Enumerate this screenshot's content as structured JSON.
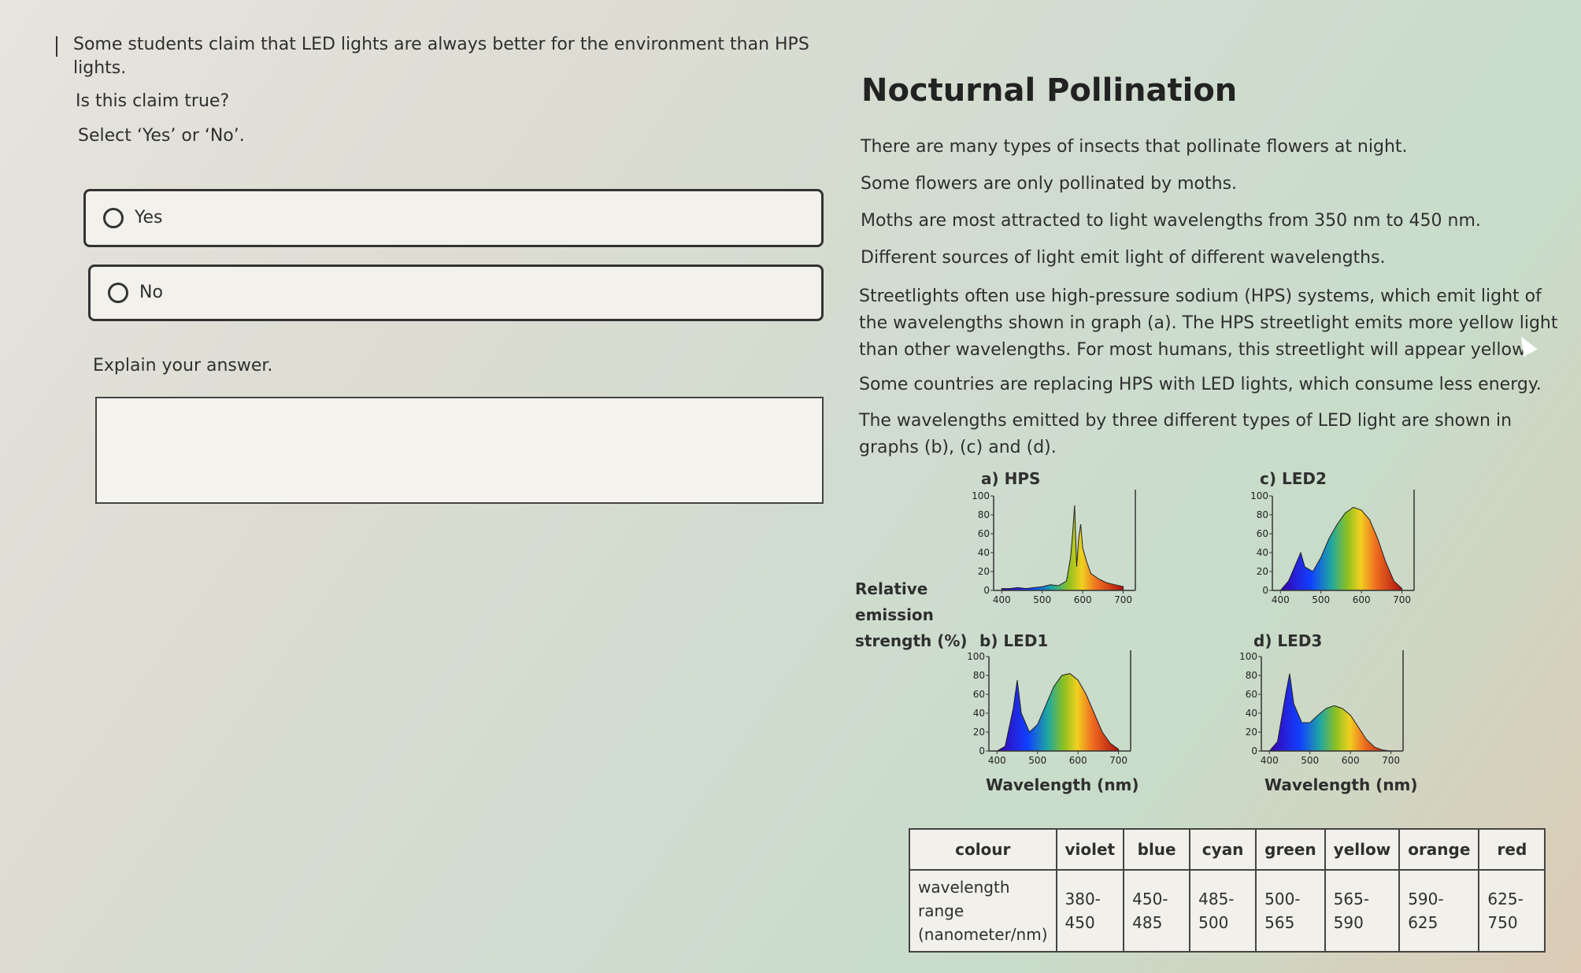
{
  "question": {
    "prompt": "Some students claim that LED lights are always better for the environment than HPS lights.",
    "ask": "Is this claim true?",
    "instruction": "Select ‘Yes’ or ‘No’.",
    "options": [
      {
        "label": "Yes"
      },
      {
        "label": "No"
      }
    ],
    "explain_label": "Explain your answer.",
    "answer_value": ""
  },
  "info": {
    "title": "Nocturnal Pollination",
    "paragraphs": [
      "There are many types of insects that pollinate flowers at night.",
      "Some flowers are only pollinated by moths.",
      "Moths are most attracted to light wavelengths from 350 nm to 450 nm.",
      "Different sources of light emit light of different wavelengths.",
      "Streetlights often use high-pressure sodium (HPS) systems, which emit light of the wavelengths shown in graph (a). The HPS streetlight emits more yellow light than other wavelengths. For most humans, this streetlight will appear yellow.",
      "Some countries are replacing HPS with LED lights, which consume less energy.",
      "The wavelengths emitted by three different types of LED light are shown in graphs (b), (c) and (d)."
    ]
  },
  "figure": {
    "ylabel_lines": [
      "Relative",
      "emission",
      "strength (%)"
    ],
    "xlabel": "Wavelength (nm)",
    "y_ticks": [
      "100",
      "80",
      "60",
      "40",
      "20",
      "0"
    ],
    "x_ticks": [
      "400",
      "500",
      "600",
      "700"
    ]
  },
  "chart_data": [
    {
      "type": "area",
      "title": "a) HPS",
      "xlabel": "",
      "ylabel": "",
      "xlim": [
        380,
        730
      ],
      "ylim": [
        0,
        100
      ],
      "x": [
        400,
        420,
        440,
        460,
        480,
        500,
        520,
        540,
        560,
        570,
        575,
        580,
        585,
        590,
        595,
        600,
        610,
        620,
        640,
        660,
        680,
        700
      ],
      "values": [
        2,
        2,
        3,
        2,
        3,
        4,
        6,
        5,
        10,
        35,
        60,
        90,
        25,
        55,
        70,
        45,
        30,
        18,
        12,
        8,
        6,
        4
      ]
    },
    {
      "type": "area",
      "title": "b) LED1",
      "xlabel": "",
      "ylabel": "",
      "xlim": [
        380,
        730
      ],
      "ylim": [
        0,
        100
      ],
      "x": [
        400,
        420,
        440,
        450,
        460,
        480,
        500,
        520,
        540,
        560,
        580,
        600,
        620,
        640,
        660,
        680,
        700
      ],
      "values": [
        0,
        5,
        45,
        75,
        40,
        20,
        28,
        48,
        68,
        80,
        82,
        75,
        60,
        40,
        20,
        8,
        2
      ]
    },
    {
      "type": "area",
      "title": "c) LED2",
      "xlabel": "",
      "ylabel": "",
      "xlim": [
        380,
        730
      ],
      "ylim": [
        0,
        100
      ],
      "x": [
        400,
        420,
        440,
        450,
        460,
        480,
        500,
        520,
        540,
        560,
        580,
        600,
        620,
        640,
        660,
        680,
        700
      ],
      "values": [
        0,
        10,
        30,
        40,
        25,
        20,
        35,
        55,
        70,
        82,
        88,
        85,
        75,
        55,
        30,
        10,
        2
      ]
    },
    {
      "type": "area",
      "title": "d) LED3",
      "xlabel": "",
      "ylabel": "",
      "xlim": [
        380,
        730
      ],
      "ylim": [
        0,
        100
      ],
      "x": [
        400,
        420,
        440,
        450,
        460,
        480,
        500,
        520,
        540,
        560,
        580,
        600,
        620,
        640,
        660,
        680,
        700
      ],
      "values": [
        0,
        10,
        60,
        82,
        50,
        30,
        30,
        38,
        45,
        48,
        45,
        38,
        25,
        12,
        4,
        1,
        0
      ]
    }
  ],
  "color_table": {
    "header": [
      "colour",
      "violet",
      "blue",
      "cyan",
      "green",
      "yellow",
      "orange",
      "red"
    ],
    "row_label": "wavelength range (nanometer/nm)",
    "ranges": [
      "380-450",
      "450-485",
      "485-500",
      "500-565",
      "565-590",
      "590-625",
      "625-750"
    ]
  }
}
